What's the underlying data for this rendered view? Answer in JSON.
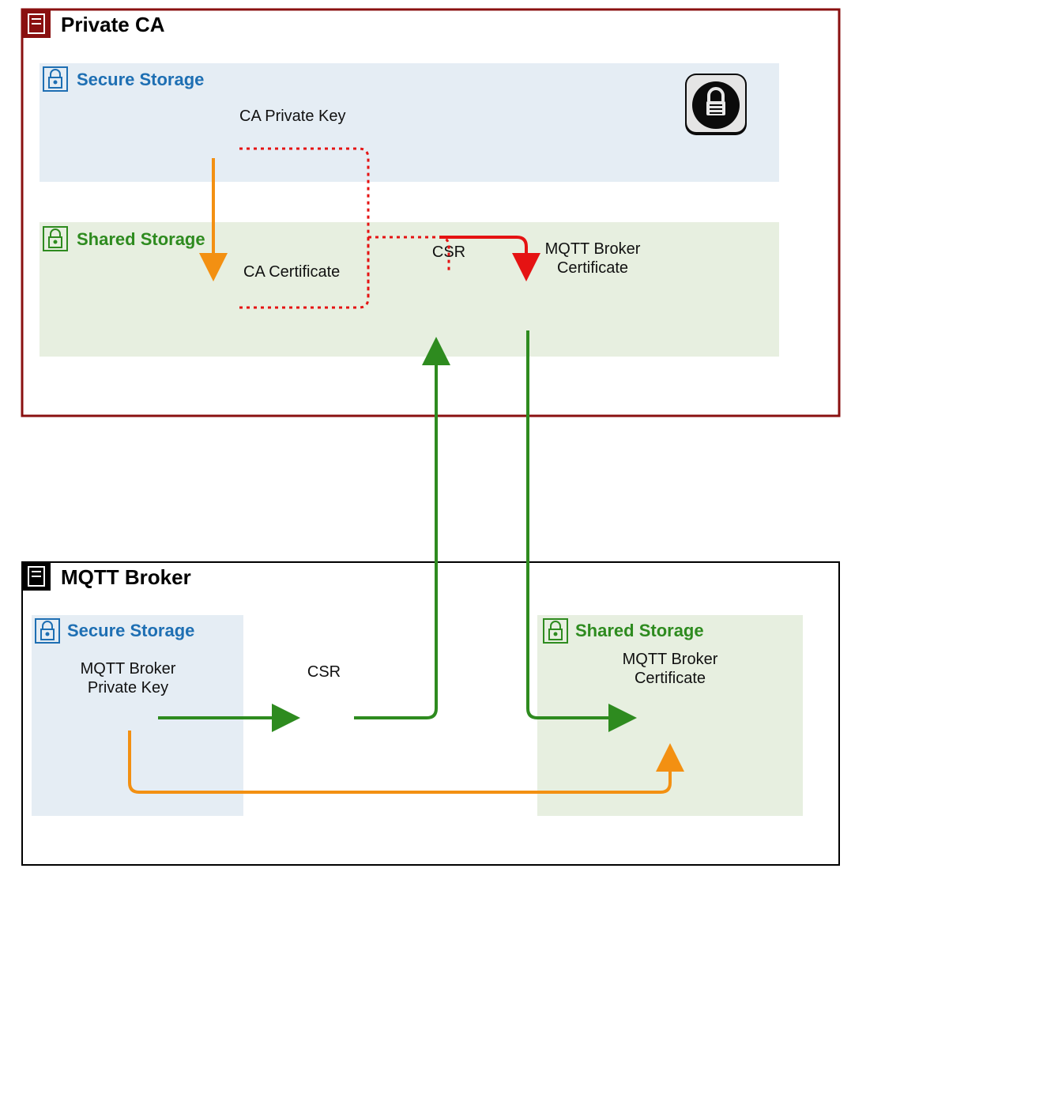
{
  "boxes": {
    "privateCA": {
      "title": "Private CA",
      "secure": "Secure Storage",
      "shared": "Shared Storage"
    },
    "mqtt": {
      "title": "MQTT Broker",
      "secure": "Secure Storage",
      "shared": "Shared Storage"
    }
  },
  "labels": {
    "caPrivateKey": "CA Private Key",
    "caCert": "CA Certificate",
    "csrTop": "CSR",
    "brokerCertTop1": "MQTT Broker",
    "brokerCertTop2": "Certificate",
    "brokerKey1": "MQTT Broker",
    "brokerKey2": "Private Key",
    "csrBottom": "CSR",
    "brokerCertBot1": "MQTT Broker",
    "brokerCertBot2": "Certificate"
  },
  "colors": {
    "darkRed": "#8a1010",
    "blue": "#1e6fb3",
    "green": "#2e8b1f",
    "orange": "#f39012",
    "red": "#e51313",
    "lightBlue": "#e5edf4",
    "lightGreen": "#e7efe0",
    "steel": "#3d6fa1",
    "ribbon": "#4f6fb0"
  }
}
